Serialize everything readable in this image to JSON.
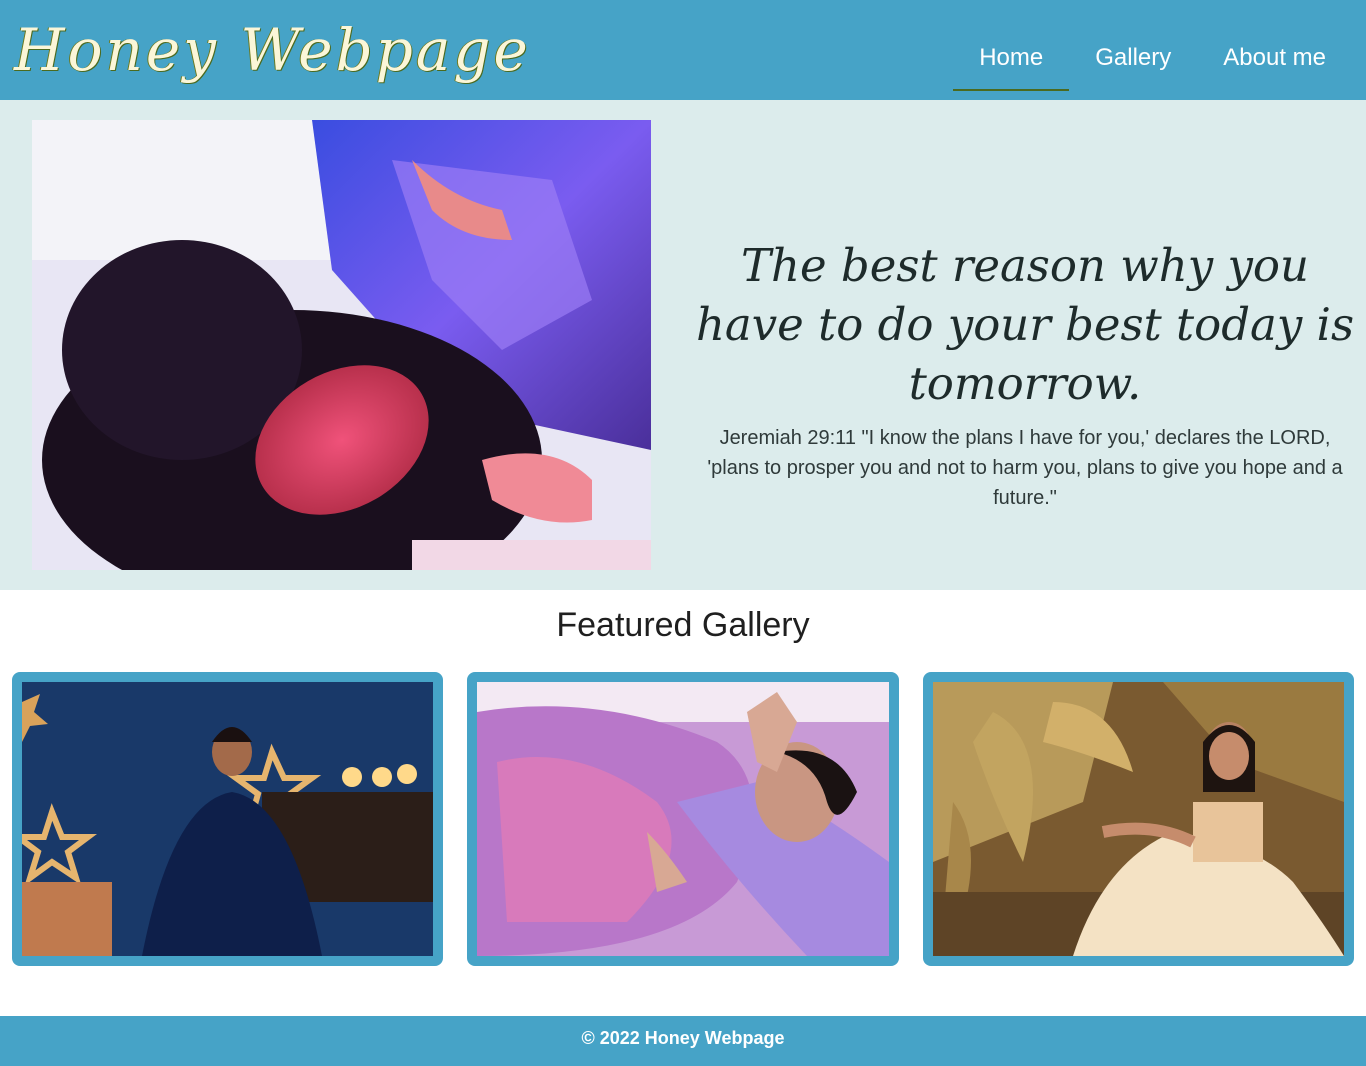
{
  "header": {
    "logo": "Honey Webpage",
    "nav": [
      {
        "label": "Home",
        "active": true
      },
      {
        "label": "Gallery",
        "active": false
      },
      {
        "label": "About me",
        "active": false
      }
    ]
  },
  "hero": {
    "quote": "The best reason why you have to do your best today is tomorrow.",
    "verse": "Jeremiah 29:11 \"I know the plans I have for you,' declares the LORD, 'plans to prosper you and not to harm you, plans to give you hope and a future.\""
  },
  "gallery": {
    "title": "Featured Gallery"
  },
  "footer": {
    "text": "© 2022 Honey Webpage"
  },
  "colors": {
    "primary": "#46a3c7",
    "hero_bg": "#dcecec",
    "nav_underline": "#4b6a1f"
  }
}
